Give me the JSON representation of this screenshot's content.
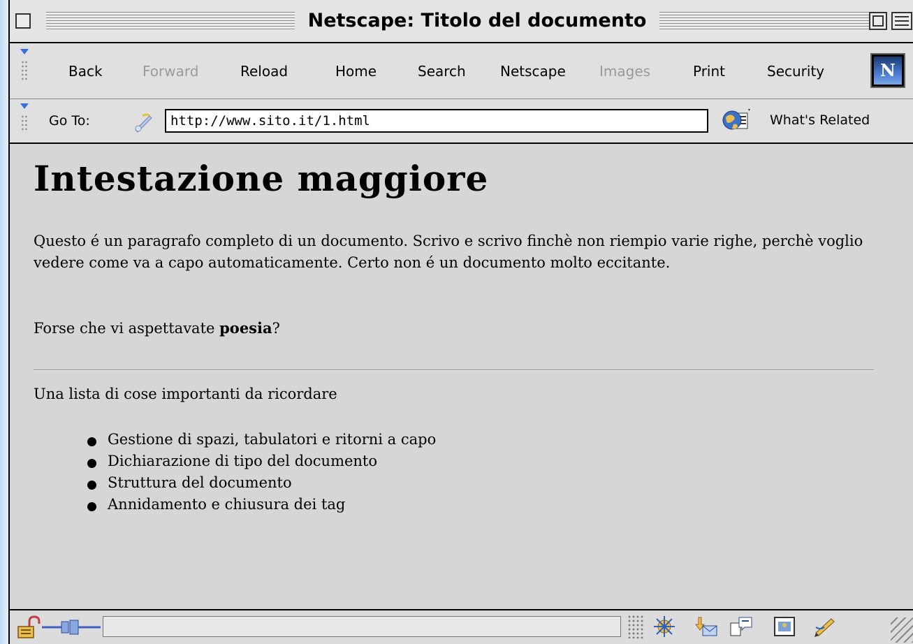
{
  "window": {
    "title": "Netscape: Titolo del documento"
  },
  "toolbar": {
    "buttons": [
      {
        "label": "Back",
        "enabled": true
      },
      {
        "label": "Forward",
        "enabled": false
      },
      {
        "label": "Reload",
        "enabled": true
      },
      {
        "label": "Home",
        "enabled": true
      },
      {
        "label": "Search",
        "enabled": true
      },
      {
        "label": "Netscape",
        "enabled": true
      },
      {
        "label": "Images",
        "enabled": false
      },
      {
        "label": "Print",
        "enabled": true
      },
      {
        "label": "Security",
        "enabled": true
      }
    ],
    "logo_letter": "N"
  },
  "location": {
    "label": "Go To:",
    "url": "http://www.sito.it/1.html",
    "related_label": "What's Related"
  },
  "page": {
    "heading": "Intestazione maggiore",
    "paragraph": "Questo é un paragrafo completo di un documento. Scrivo e scrivo finchè non riempio varie righe, perchè voglio vedere come va a capo automaticamente. Certo non é un documento molto eccitante.",
    "question_prefix": "Forse che vi aspettavate ",
    "question_bold": "poesia",
    "question_suffix": "?",
    "list_intro": "Una lista di cose importanti da ricordare",
    "list_items": [
      "Gestione di spazi, tabulatori e ritorni a capo",
      "Dichiarazione di tipo del documento",
      "Struttura del documento",
      "Annidamento e chiusura dei tag"
    ]
  },
  "status": {
    "text": "",
    "icons": [
      "security-lock-icon",
      "connection-plug-icon",
      "component-bar-icon",
      "navigator-icon",
      "mail-icon",
      "composer-icon",
      "newsgroup-icon",
      "address-book-icon",
      "editor-icon"
    ]
  },
  "colors": {
    "chrome": "#e0e0e0",
    "content_background": "#d6d6d6",
    "link_accent": "#3a6ed8"
  }
}
